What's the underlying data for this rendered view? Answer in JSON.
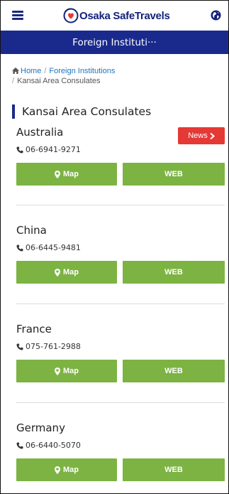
{
  "header": {
    "logo_text": "Osaka SafeTravels",
    "brand_color": "#13227a"
  },
  "titlebar": {
    "title": "Foreign Instituti···",
    "color": "#1a2a8c"
  },
  "breadcrumb": {
    "home": "Home",
    "parent": "Foreign Institutions",
    "current": "Kansai Area Consulates"
  },
  "page": {
    "heading": "Kansai Area Consulates"
  },
  "buttons": {
    "map_label": "Map",
    "web_label": "WEB",
    "news_label": "News",
    "map_color": "#7cb342",
    "news_color": "#e53935"
  },
  "consulates": [
    {
      "country": "Australia",
      "phone": "06-6941-9271",
      "has_news": true
    },
    {
      "country": "China",
      "phone": "06-6445-9481",
      "has_news": false
    },
    {
      "country": "France",
      "phone": "075-761-2988",
      "has_news": false
    },
    {
      "country": "Germany",
      "phone": "06-6440-5070",
      "has_news": false
    }
  ]
}
